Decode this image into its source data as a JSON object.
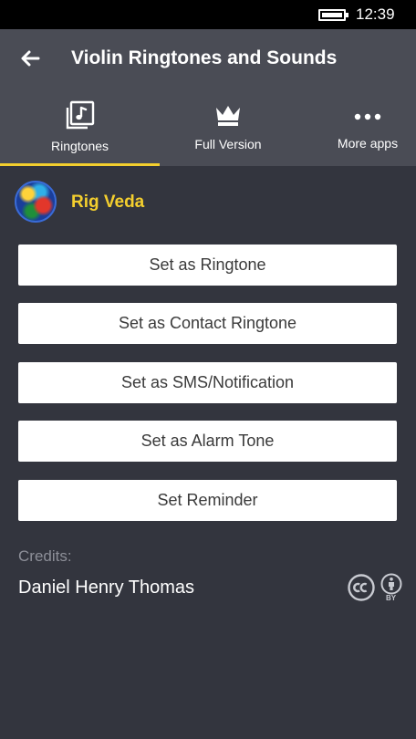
{
  "status_bar": {
    "time": "12:39",
    "battery_icon": "battery-icon"
  },
  "header": {
    "back_icon": "back-arrow-icon",
    "title": "Violin Ringtones and Sounds"
  },
  "tabs": [
    {
      "label": "Ringtones",
      "icon": "music-library-icon",
      "selected": true
    },
    {
      "label": "Full Version",
      "icon": "crown-icon",
      "selected": false
    },
    {
      "label": "More apps",
      "icon": "more-dots-icon",
      "selected": false
    }
  ],
  "accent_color": "#f4cf2e",
  "ringtone": {
    "name": "Rig Veda"
  },
  "actions": [
    {
      "label": "Set as Ringtone"
    },
    {
      "label": "Set as Contact Ringtone"
    },
    {
      "label": "Set as SMS/Notification"
    },
    {
      "label": "Set as Alarm Tone"
    },
    {
      "label": "Set Reminder"
    }
  ],
  "credits": {
    "label": "Credits:",
    "author": "Daniel Henry Thomas",
    "license_icons": [
      "cc-icon",
      "by-attribution-icon"
    ],
    "license_badge": "BY"
  }
}
